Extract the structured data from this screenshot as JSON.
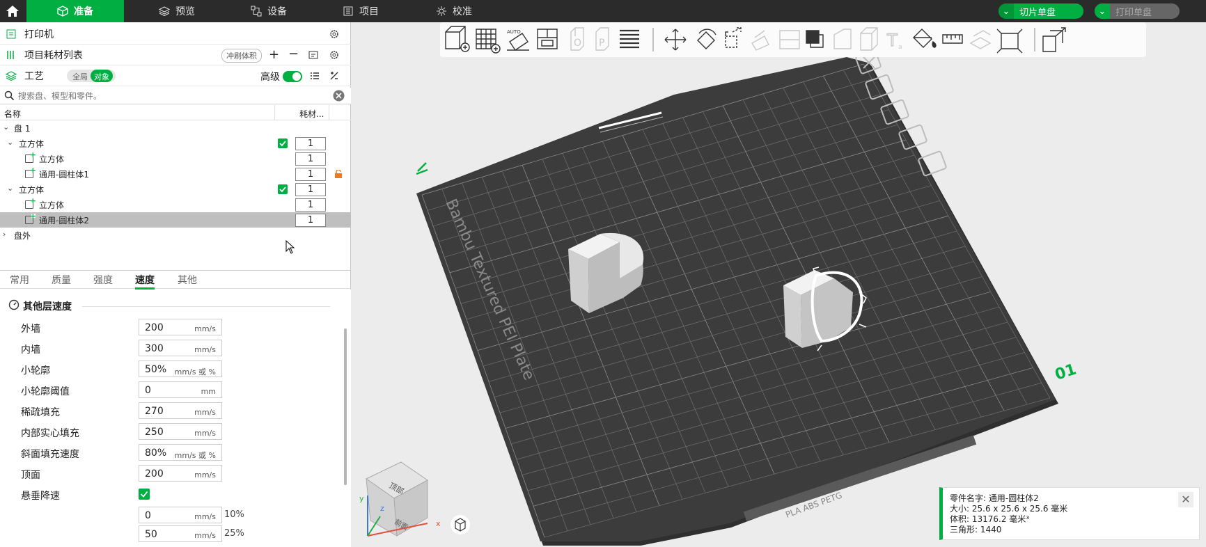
{
  "topbar": {
    "tabs": [
      {
        "label": "准备",
        "icon": "cube-icon"
      },
      {
        "label": "预览",
        "icon": "layers-icon"
      },
      {
        "label": "设备",
        "icon": "device-icon"
      },
      {
        "label": "项目",
        "icon": "project-icon"
      },
      {
        "label": "校准",
        "icon": "calibration-icon"
      }
    ],
    "slice_label": "切片单盘",
    "print_label": "打印单盘"
  },
  "sidebar": {
    "printer_label": "打印机",
    "filament_label": "项目耗材列表",
    "flush_label": "冲刷体积",
    "process_label": "工艺",
    "toggle_global": "全局",
    "toggle_object": "对象",
    "advanced_label": "高级",
    "search_placeholder": "搜索盘、模型和零件。"
  },
  "tree": {
    "col_name": "名称",
    "col_filament": "耗材...",
    "rows": [
      {
        "label": "盘 1",
        "level": 0,
        "qty": ""
      },
      {
        "label": "立方体",
        "level": 1,
        "qty": "1"
      },
      {
        "label": "立方体",
        "level": 2,
        "qty": "1"
      },
      {
        "label": "通用-圆柱体1",
        "level": 2,
        "qty": "1"
      },
      {
        "label": "立方体",
        "level": 1,
        "qty": "1"
      },
      {
        "label": "立方体",
        "level": 2,
        "qty": "1"
      },
      {
        "label": "通用-圆柱体2",
        "level": 2,
        "qty": "1"
      },
      {
        "label": "盘外",
        "level": 0,
        "qty": ""
      }
    ]
  },
  "param_tabs": [
    "常用",
    "质量",
    "强度",
    "速度",
    "其他"
  ],
  "params": {
    "section": "其他层速度",
    "rows": [
      {
        "label": "外墙",
        "value": "200",
        "unit": "mm/s"
      },
      {
        "label": "内墙",
        "value": "300",
        "unit": "mm/s"
      },
      {
        "label": "小轮廓",
        "value": "50%",
        "unit": "mm/s 或 %"
      },
      {
        "label": "小轮廓阈值",
        "value": "0",
        "unit": "mm"
      },
      {
        "label": "稀疏填充",
        "value": "270",
        "unit": "mm/s"
      },
      {
        "label": "内部实心填充",
        "value": "250",
        "unit": "mm/s"
      },
      {
        "label": "斜面填充速度",
        "value": "80%",
        "unit": "mm/s 或 %"
      },
      {
        "label": "顶面",
        "value": "200",
        "unit": "mm/s"
      }
    ],
    "overhang_label": "悬垂降速",
    "overhang_rows": [
      {
        "value": "0",
        "unit": "mm/s",
        "pct": "10%"
      },
      {
        "value": "50",
        "unit": "mm/s",
        "pct": "25%"
      }
    ]
  },
  "viewport": {
    "plate_text": "Bambu Textured PEI Plate",
    "plate_number": "01",
    "bottom_label": "PLA ABS PETG",
    "view_cube_top": "顶部",
    "view_cube_front": "前面"
  },
  "info": {
    "name_label": "零件名字:",
    "name_value": "通用-圆柱体2",
    "size_label": "大小:",
    "size_value": "25.6 x 25.6 x 25.6 毫米",
    "volume_label": "体积:",
    "volume_value": "13176.2 毫米³",
    "tri_label": "三角形:",
    "tri_value": "1440"
  },
  "colors": {
    "accent": "#00ae42",
    "topbar": "#2b2b2b",
    "plate": "#3a3a3a"
  }
}
